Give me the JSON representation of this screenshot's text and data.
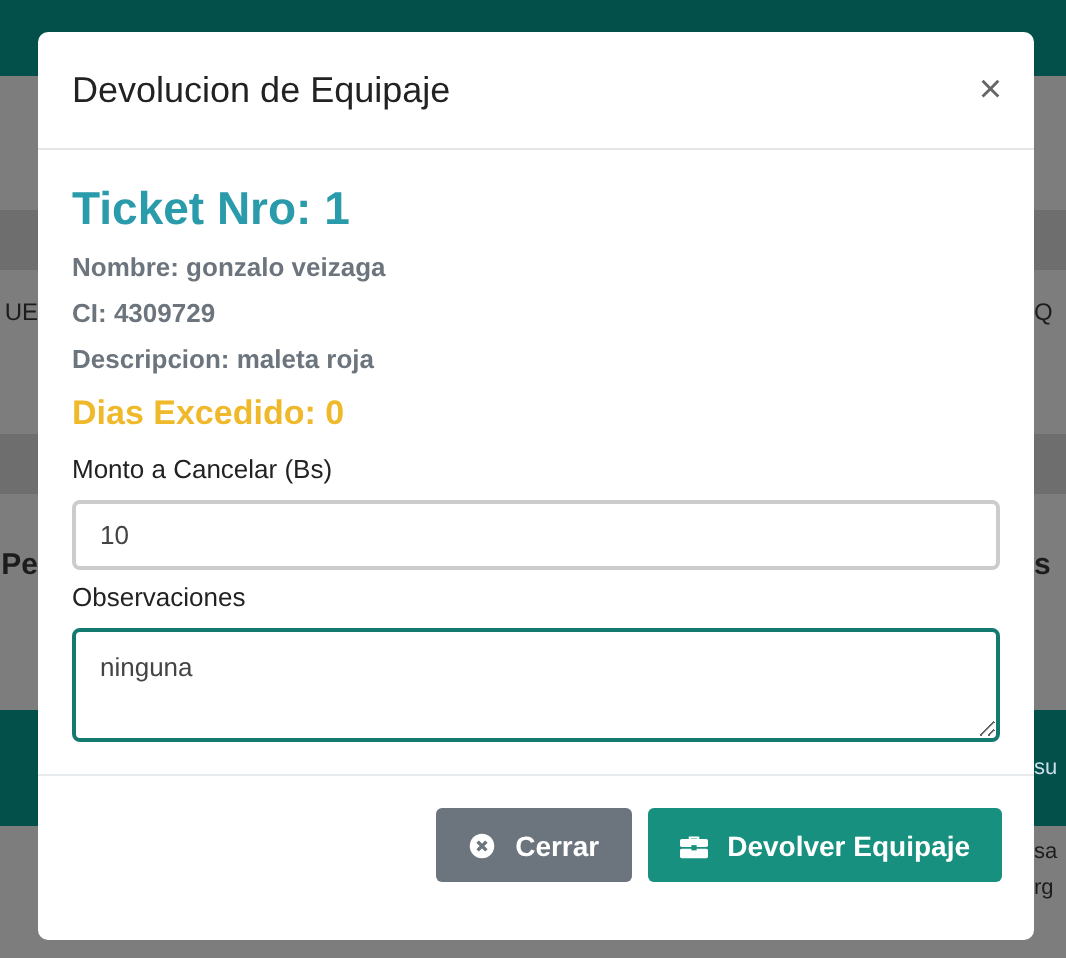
{
  "background": {
    "rows": [
      {
        "kind": "band"
      },
      {
        "kind": "text",
        "left": "UE",
        "right": "Q"
      },
      {
        "kind": "band"
      },
      {
        "kind": "title",
        "left": "Pe",
        "right": "s"
      },
      {
        "kind": "table_header",
        "left": "",
        "right": "su"
      },
      {
        "kind": "table_row",
        "left": "",
        "right": "sa"
      },
      {
        "kind": "table_row",
        "left": "",
        "right": "rg"
      }
    ]
  },
  "modal": {
    "title": "Devolucion de Equipaje",
    "close": "×",
    "ticket": "Ticket Nro: 1",
    "details": [
      "Nombre: gonzalo veizaga",
      "CI: 4309729",
      "Descripcion: maleta roja"
    ],
    "days_exceeded": "Dias Excedido: 0",
    "fields": [
      {
        "kind": "input",
        "label": "Monto a Cancelar (Bs)",
        "value": "10",
        "focused": false
      },
      {
        "kind": "textarea",
        "label": "Observaciones",
        "value": "ninguna",
        "focused": true
      }
    ],
    "buttons": [
      {
        "kind": "close",
        "label": "Cerrar"
      },
      {
        "kind": "confirm",
        "label": "Devolver Equipaje"
      }
    ]
  }
}
